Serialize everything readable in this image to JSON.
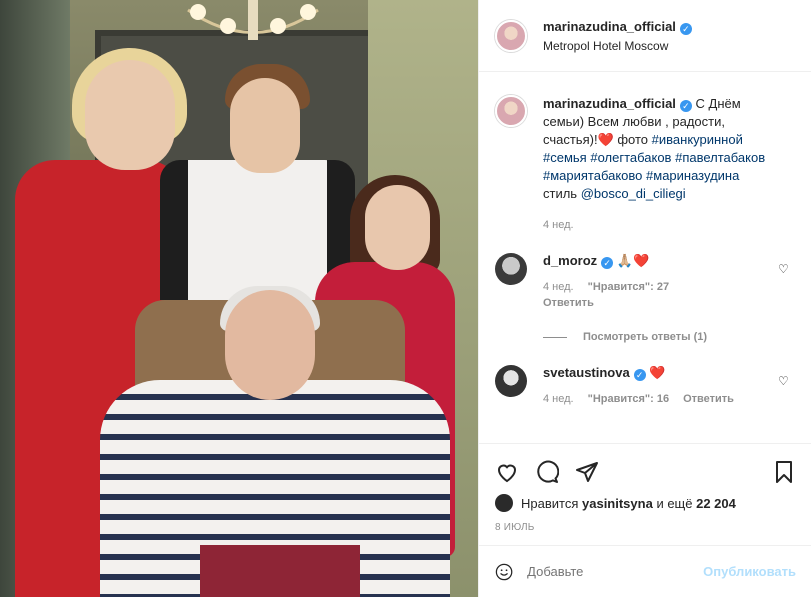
{
  "post": {
    "author": "marinazudina_official",
    "location": "Metropol Hotel Moscow"
  },
  "caption": {
    "author": "marinazudina_official",
    "text_1": " С Днём семьи) Всем любви , радости, счастья)!❤️ фото ",
    "tag_1": "#иванкуринной",
    "tag_2": "#семья",
    "tag_3": "#олегтабаков",
    "tag_4": "#павелтабаков",
    "tag_5": "#мариятабаково",
    "tag_6": "#мариназудина",
    "text_2": " стиль ",
    "mention": "@bosco_di_ciliegi",
    "time": "4 нед."
  },
  "comments": [
    {
      "user": "d_moroz",
      "text": "🙏🏼❤️",
      "time": "4 нед.",
      "likes": "\"Нравится\": 27",
      "reply": "Ответить"
    },
    {
      "user": "svetaustinova",
      "text": "❤️",
      "time": "4 нед.",
      "likes": "\"Нравится\": 16",
      "reply": "Ответить"
    }
  ],
  "replies_label": "Посмотреть ответы (1)",
  "likes": {
    "prefix": "Нравится",
    "user": "yasinitsyna",
    "suffix": "и ещё",
    "count": "22 204"
  },
  "date": "8 июль",
  "add_comment": {
    "placeholder": "Добавьте",
    "publish": "Опубликовать"
  },
  "icons": {
    "verified": "verified-icon",
    "like": "heart-icon",
    "comment": "comment-icon",
    "share": "share-icon",
    "save": "bookmark-icon",
    "emoji": "emoji-icon"
  }
}
